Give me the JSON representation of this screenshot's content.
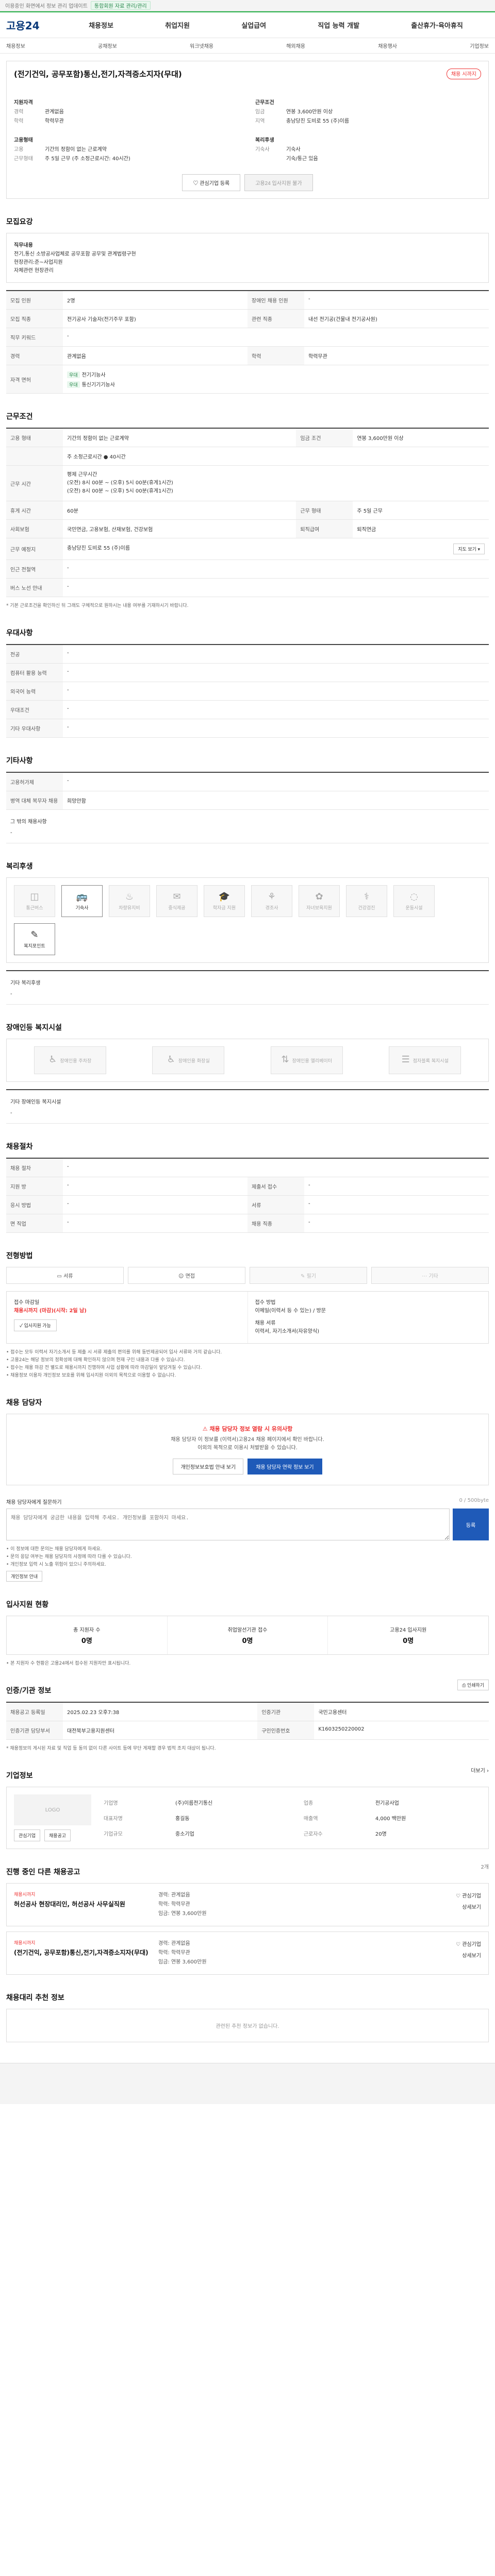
{
  "topbar": {
    "text": "이용중인 화면에서 정보 관리 업데이트",
    "badge": "통합회원 자료 관리/관리"
  },
  "header": {
    "logo": "고용24",
    "gnb": [
      "채용정보",
      "취업지원",
      "실업급여",
      "직업 능력 개발",
      "출산휴가·육아휴직"
    ]
  },
  "subnav": [
    "채용정보",
    "공채정보",
    "워크넷채용",
    "해외채용",
    "채용행사",
    "기업정보"
  ],
  "job": {
    "title": "(전기건익, 공무포함)통신,전기,자격증소지자(무대)",
    "pill": "채용 시까지",
    "left_kv": [
      {
        "k": "지원자격",
        "v": ""
      },
      {
        "k": "경력",
        "v": "관계없음"
      },
      {
        "k": "학력",
        "v": "학력무관"
      }
    ],
    "right_kv": [
      {
        "k": "근무조건",
        "v": ""
      },
      {
        "k": "임금",
        "v": "연봉 3,600만원 이상"
      },
      {
        "k": "지역",
        "v": "충남당진 도비로 55 (주)이름"
      }
    ],
    "left_kv2": [
      {
        "k": "고용형태",
        "v": ""
      },
      {
        "k": "고용",
        "v": "기간의 정함이 없는 근로계약"
      },
      {
        "k": "근무형태",
        "v": "주 5일 근무 (주 소정근로시간: 40시간)"
      }
    ],
    "right_kv2": [
      {
        "k": "복리후생",
        "v": ""
      },
      {
        "k": "기숙사",
        "v": "기숙사"
      },
      {
        "k": "",
        "v": "기숙/통근 있음"
      }
    ],
    "btn_interest": "관심기업 등록",
    "btn_apply": "고용24 입사지원 불가"
  },
  "recruit": {
    "title": "모집요강",
    "duty_label": "직무내용",
    "duty_text": "전기,통신 소방공사업체로 공무포함 공무및 관계법령구현\n현장관리:준~사업지원\n자체관련 현장관리",
    "rows": [
      {
        "k": "모집 인원",
        "v": "2명",
        "k2": "장애인 채용 인원",
        "v2": "-"
      },
      {
        "k": "모집 직종",
        "v": "전기공사 기술자(전기주무 포함)",
        "k2": "관련 직종",
        "v2": "내선 전기공(건물내 전기공사원)"
      },
      {
        "k": "직무 키워드",
        "v": "-",
        "k2": "",
        "v2": ""
      },
      {
        "k": "경력",
        "v": "관계없음",
        "k2": "학력",
        "v2": "학력무관"
      },
      {
        "k": "자격 면허",
        "v": "",
        "k2": "",
        "v2": ""
      }
    ],
    "license_tags": [
      "우대",
      "우대"
    ],
    "licenses": [
      "전기기능사",
      "통신기기기능사"
    ]
  },
  "conditions": {
    "title": "근무조건",
    "rows": [
      {
        "k": "고용 형태",
        "v": "기간의 정함이 없는 근로계약",
        "k2": "임금 조건",
        "v2": "연봉 3,600만원 이상"
      },
      {
        "k": "",
        "v": "주 소정근로시간 ● 40시간",
        "k2": "",
        "v2": ""
      },
      {
        "k": "근무 시간",
        "v": "평제 근무시간\n(오전) 8시 00분 ~ (오후) 5시 00분(휴게1시간)\n(오전) 8시 00분 ~ (오후) 5시 00분(휴게1시간)",
        "k2": "",
        "v2": ""
      },
      {
        "k": "휴게 시간",
        "v": "60분",
        "k2": "근무 형태",
        "v2": "주 5일 근무"
      },
      {
        "k": "사회보험",
        "v": "국민연금, 고용보험, 산재보험, 건강보험",
        "k2": "퇴직급여",
        "v2": "퇴직연금"
      },
      {
        "k": "근무 예정지",
        "v": "충남당진 도비로 55 (주)이름",
        "k2": "",
        "v2": ""
      },
      {
        "k": "인근 전철역",
        "v": "-",
        "k2": "",
        "v2": ""
      },
      {
        "k": "버스 노선 안내",
        "v": "-",
        "k2": "",
        "v2": ""
      }
    ],
    "map_btn": "지도 보기",
    "note": "* 기본 근로조건을 확인하신 뒤 그래도 구체적으로 원하시는 내용 여부를 기재하시기 바랍니다."
  },
  "preference": {
    "title": "우대사항",
    "rows": [
      {
        "k": "전공",
        "v": "-"
      },
      {
        "k": "컴퓨터 활용 능력",
        "v": "-"
      },
      {
        "k": "외국어 능력",
        "v": "-"
      },
      {
        "k": "우대조건",
        "v": "-"
      },
      {
        "k": "기타 우대사항",
        "v": "-"
      }
    ]
  },
  "etc": {
    "title": "기타사항",
    "rows": [
      {
        "k": "고용허가제",
        "v": "-"
      },
      {
        "k": "병역 대체 복무자 채용",
        "v": "희망안함"
      }
    ],
    "other_label": "그 밖의 채용사항",
    "other_value": "-"
  },
  "welfare": {
    "title": "복리후생",
    "items": [
      {
        "icon": "◫",
        "label": "통근버스",
        "active": false
      },
      {
        "icon": "🚌",
        "label": "기숙사",
        "active": true
      },
      {
        "icon": "♨",
        "label": "차량유지비",
        "active": false
      },
      {
        "icon": "✉",
        "label": "중식제공",
        "active": false
      },
      {
        "icon": "🎓",
        "label": "학자금 지원",
        "active": false
      },
      {
        "icon": "⚘",
        "label": "경조사",
        "active": false
      },
      {
        "icon": "✿",
        "label": "자녀보육지원",
        "active": false
      },
      {
        "icon": "⚕",
        "label": "건강검진",
        "active": false
      },
      {
        "icon": "◌",
        "label": "운동시설",
        "active": false
      },
      {
        "icon": "✎",
        "label": "복지포인트",
        "active": true
      }
    ],
    "other_label": "기타 복리후생",
    "other_value": "-"
  },
  "disability": {
    "title": "장애인등 복지시설",
    "items": [
      {
        "icon": "♿",
        "label": "장애인용 주차장"
      },
      {
        "icon": "♿",
        "label": "장애인용 화장실"
      },
      {
        "icon": "⇅",
        "label": "장애인용 엘리베이터"
      },
      {
        "icon": "☰",
        "label": "점자블록 복지시설"
      }
    ],
    "other_label": "기타 장애인등 복지시설",
    "other_value": "-"
  },
  "selection": {
    "title": "채용절차",
    "rows": [
      {
        "k": "채용 절차",
        "v": "-",
        "k2": "",
        "v2": ""
      },
      {
        "k": "지원 방",
        "v": "-",
        "k2": "제출서 접수",
        "v2": "-"
      },
      {
        "k": "응시 방법",
        "v": "-",
        "k2": "서류",
        "v2": "-"
      },
      {
        "k": "면 직업",
        "v": "-",
        "k2": "채용 직종",
        "v2": "-"
      }
    ]
  },
  "apply": {
    "title": "전형방법",
    "tabs": [
      "서류",
      "면접",
      "필기",
      "기타"
    ],
    "deadline_label": "접수 마감일",
    "deadline_value": "채용시까지 (마감)(시작: 2일 남)",
    "method_label": "접수 방법",
    "method_value": "이메일(이력서 등 수 있는) / 방문",
    "contact_label": "채용 서류",
    "contact_value": "이력서, 자기소개서(자유양식)",
    "btn": "입사지원 가능",
    "notes": [
      "• 접수는 모두 이력서 자기소개서 등 제출 시 서류 제출의 편의를 위해 동반제공되어 입사 서류와 거의 같습니다.",
      "• 고용24는 해당 정보의 정확성에 대해 확인하지 않으며 현재 구인 내용과 다를 수 있습니다.",
      "• 접수는 채용 마감 전 별도로 채용시까지 진행하며 사업 상황에 따라 마감일이 앞당겨질 수 있습니다.",
      "• 채용정보 이용자 개인정보 보호를 위해 입사지원 이외의 목적으로 이용할 수 없습니다."
    ]
  },
  "manager": {
    "title": "채용 담당자",
    "alert_title": "채용 담당자 정보 열람 시 유의사항",
    "alert_body": "채용 담당자 이 정보를 (이력서)고용24 채용 페이지에서 확인 바랍니다.\n이외의 목적으로 이용시 처벌받을 수 있습니다.",
    "btn1": "개인정보보호법 안내 보기",
    "btn2": "채용 담당자 연락 정보 보기",
    "inquiry_label": "채용 담당자에게 질문하기",
    "inquiry_placeholder": "채용 담당자에게 궁금한 내용을 입력해 주세요. 개인정보를 포함하지 마세요.",
    "inquiry_count": "0 / 500byte",
    "inquiry_btn": "등록",
    "notes": [
      "• 이 정보에 대한 문의는 채용 담당자에게 하세요.",
      "• 문의 응답 여부는 채용 담당자의 사정에 따라 다를 수 있습니다.",
      "• 개인정보 입력 시 노출 위험이 있으니 주의하세요."
    ],
    "notes_btn": "개인정보 안내"
  },
  "status": {
    "title": "입사지원 현황",
    "items": [
      {
        "label": "총 지원자 수",
        "value": "0명"
      },
      {
        "label": "취업알선기관 접수",
        "value": "0명"
      },
      {
        "label": "고용24 입사지원",
        "value": "0명"
      }
    ],
    "note": "• 본 지원자 수 현황은 고용24에서 접수된 지원자만 표시됩니다."
  },
  "info": {
    "title": "인증/기관 정보",
    "print_btn": "인쇄하기",
    "rows": [
      {
        "k": "채용공고 등록일",
        "v": "2025.02.23 오후7:38",
        "k2": "인증기관",
        "v2": "국민고용센터"
      },
      {
        "k": "인증기관 담당부서",
        "v": "대전북부고용지원센터",
        "k2": "구인인증번호",
        "v2": "K1603250220002"
      }
    ],
    "notes": "* 채용정보의 게시된 자료 및 직업 등 동의 없이 다른 사이트 등에 무단 게재할 경우 법적 조치 대상이 됩니다."
  },
  "company": {
    "title": "기업정보",
    "more": "더보기",
    "logo": "LOGO",
    "rows": [
      {
        "k": "기업명",
        "v": "(주)이름전기통신",
        "k2": "업종",
        "v2": "전기공사업"
      },
      {
        "k": "대표자명",
        "v": "홍길동",
        "k2": "매출액",
        "v2": "4,000 백만원"
      },
      {
        "k": "기업규모",
        "v": "중소기업",
        "k2": "근로자수",
        "v2": "20명"
      }
    ],
    "btn1": "관심기업",
    "btn2": "채용공고"
  },
  "ongoing": {
    "title": "진행 중인 다른 채용공고",
    "subtitle": "2개",
    "jobs": [
      {
        "label": "채용시까지",
        "title": "허선공사 현장대리인, 허선공사 사무실직원",
        "info": [
          "경력: 관계없음",
          "학력: 학력무관",
          "임금: 연봉 3,600만원"
        ],
        "right": [
          "관심기업",
          "상세보기"
        ]
      },
      {
        "label": "채용시까지",
        "title": "(전기건익, 공무포함)통신,전기,자격증소지자(무대)",
        "info": [
          "경력: 관계없음",
          "학력: 학력무관",
          "임금: 연봉 3,600만원"
        ],
        "right": [
          "관심기업",
          "상세보기"
        ]
      }
    ]
  },
  "recommend": {
    "title": "채용대리 추천 정보",
    "empty": "관련된 추천 정보가 없습니다."
  }
}
